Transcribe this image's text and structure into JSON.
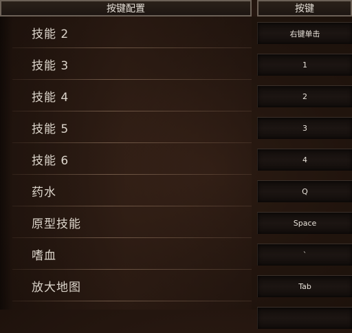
{
  "header": {
    "config_title": "按键配置",
    "key_title": "按键"
  },
  "rows": [
    {
      "label": "技能 2",
      "key": "右键单击"
    },
    {
      "label": "技能 3",
      "key": "1"
    },
    {
      "label": "技能 4",
      "key": "2"
    },
    {
      "label": "技能 5",
      "key": "3"
    },
    {
      "label": "技能 6",
      "key": "4"
    },
    {
      "label": "药水",
      "key": "Q"
    },
    {
      "label": "原型技能",
      "key": "Space"
    },
    {
      "label": "嗜血",
      "key": "`"
    },
    {
      "label": "放大地图",
      "key": "Tab"
    },
    {
      "label": "",
      "key": ""
    }
  ],
  "colors": {
    "background": "#2a1a12",
    "header_border": "#6d6258",
    "text": "#ddd6cc",
    "key_button": "#1c1512"
  }
}
